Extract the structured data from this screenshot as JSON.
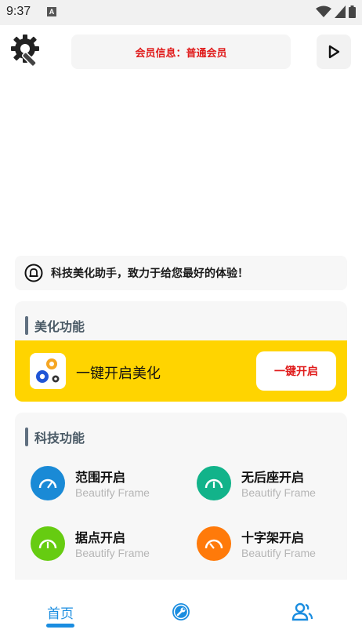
{
  "status_bar": {
    "time": "9:37",
    "a_badge": "A"
  },
  "header": {
    "member_info": "会员信息：普通会员"
  },
  "notice": {
    "text": "科技美化助手，致力于给您最好的体验！"
  },
  "beautify": {
    "section_title": "美化功能",
    "item_label": "一键开启美化",
    "button_label": "一键开启"
  },
  "tech": {
    "section_title": "科技功能",
    "features": [
      {
        "title": "范围开启",
        "subtitle": "Beautify Frame",
        "color": "#1a8ad6"
      },
      {
        "title": "无后座开启",
        "subtitle": "Beautify Frame",
        "color": "#12b38a"
      },
      {
        "title": "据点开启",
        "subtitle": "Beautify Frame",
        "color": "#66cc11"
      },
      {
        "title": "十字架开启",
        "subtitle": "Beautify Frame",
        "color": "#ff7a0a"
      }
    ]
  },
  "bottom_nav": {
    "home_label": "首页",
    "tabs": [
      "home",
      "tools-icon",
      "users-icon"
    ]
  },
  "colors": {
    "accent": "#1a8de0",
    "highlight": "#ffd400",
    "alert": "#e01a1a"
  }
}
